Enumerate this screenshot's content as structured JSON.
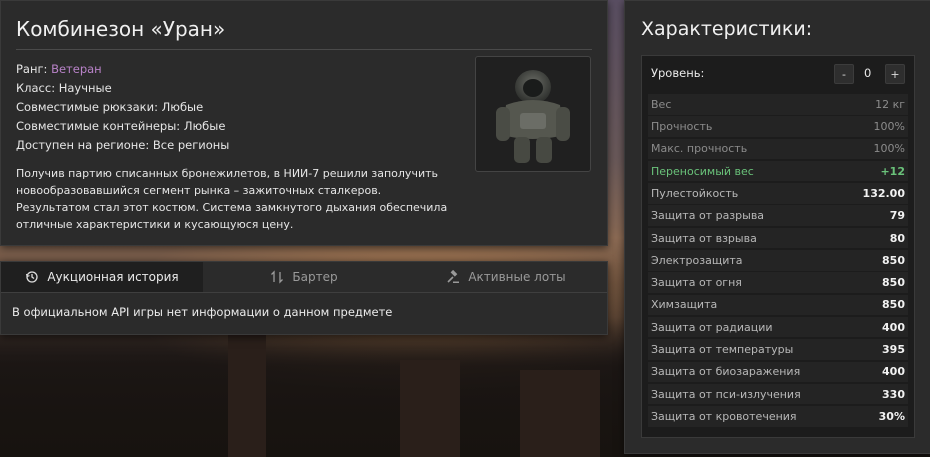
{
  "item": {
    "title": "Комбинезон «Уран»",
    "rank_label": "Ранг:",
    "rank_value": "Ветеран",
    "class_line": "Класс: Научные",
    "backpacks_line": "Совместимые рюкзаки: Любые",
    "containers_line": "Совместимые контейнеры: Любые",
    "region_line": "Доступен на регионе: Все регионы",
    "description": "Получив партию списанных бронежилетов, в НИИ-7 решили заполучить новообразовавшийся сегмент рынка – зажиточных сталкеров. Результатом стал этот костюм. Система замкнутого дыхания обеспечила отличные характеристики и кусающуюся цену."
  },
  "tabs": [
    {
      "label": "Аукционная история",
      "icon": "history-icon",
      "active": true
    },
    {
      "label": "Бартер",
      "icon": "swap-icon",
      "active": false
    },
    {
      "label": "Активные лоты",
      "icon": "gavel-icon",
      "active": false
    }
  ],
  "tab_content": "В официальном API игры нет информации о данном предмете",
  "stats": {
    "title": "Характеристики:",
    "level_label": "Уровень:",
    "level_value": "0",
    "minus": "-",
    "plus": "+",
    "rows": [
      {
        "label": "Вес",
        "value": "12 кг",
        "style": "dim"
      },
      {
        "label": "Прочность",
        "value": "100%",
        "style": "dim"
      },
      {
        "label": "Макс. прочность",
        "value": "100%",
        "style": "dim"
      },
      {
        "label": "Переносимый вес",
        "value": "+12",
        "style": "green"
      },
      {
        "label": "Пулестойкость",
        "value": "132.00",
        "style": "light"
      },
      {
        "label": "Защита от разрыва",
        "value": "79",
        "style": "light"
      },
      {
        "label": "Защита от взрыва",
        "value": "80",
        "style": "light"
      },
      {
        "label": "Электрозащита",
        "value": "850",
        "style": "light"
      },
      {
        "label": "Защита от огня",
        "value": "850",
        "style": "light"
      },
      {
        "label": "Химзащита",
        "value": "850",
        "style": "light"
      },
      {
        "label": "Защита от радиации",
        "value": "400",
        "style": "light"
      },
      {
        "label": "Защита от температуры",
        "value": "395",
        "style": "light"
      },
      {
        "label": "Защита от биозаражения",
        "value": "400",
        "style": "light"
      },
      {
        "label": "Защита от пси-излучения",
        "value": "330",
        "style": "light"
      },
      {
        "label": "Защита от кровотечения",
        "value": "30%",
        "style": "light"
      }
    ]
  },
  "colors": {
    "rank": "#b983c9",
    "positive": "#6ac27a"
  }
}
